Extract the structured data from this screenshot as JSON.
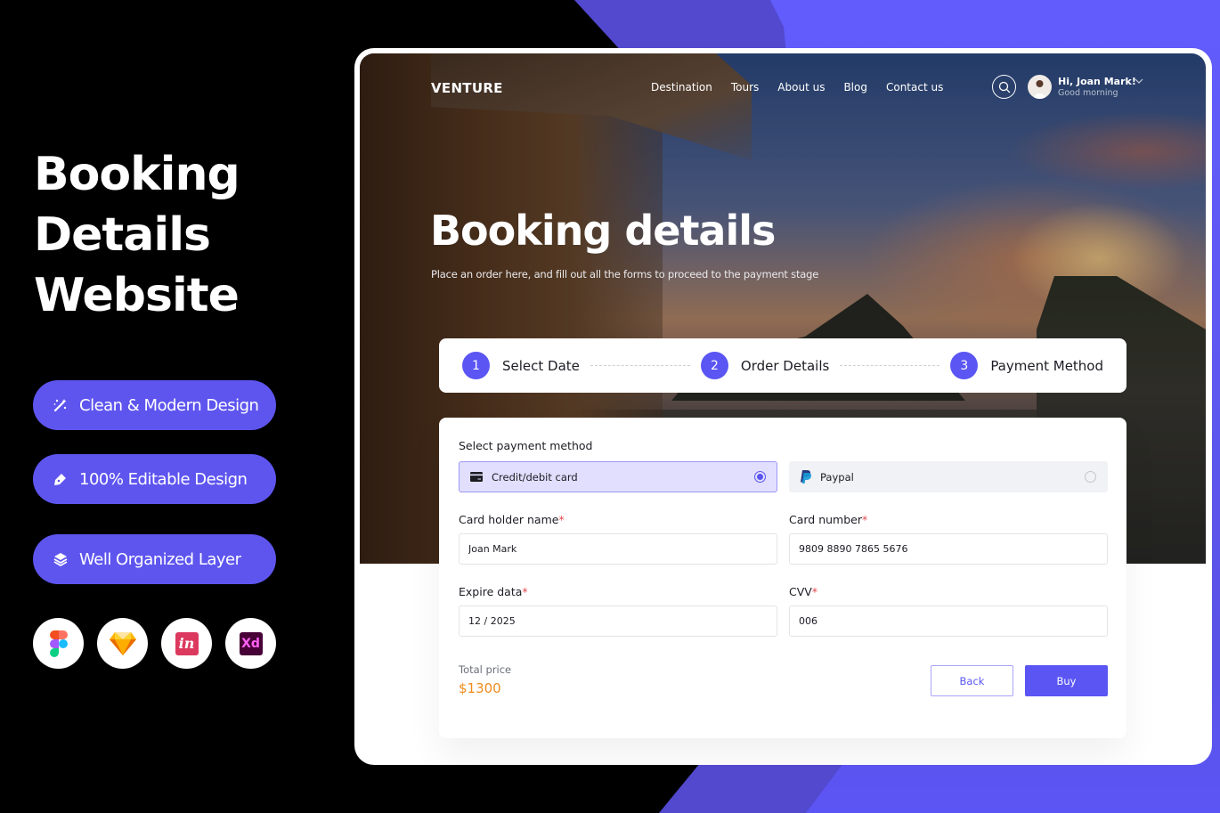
{
  "promo": {
    "title_lines": [
      "Booking",
      "Details",
      "Website"
    ],
    "features": [
      {
        "icon": "magic-wand-icon",
        "label": "Clean & Modern  Design"
      },
      {
        "icon": "pen-edit-icon",
        "label": "100% Editable Design"
      },
      {
        "icon": "layers-icon",
        "label": "Well Organized Layer"
      }
    ],
    "tools": [
      "figma-icon",
      "sketch-icon",
      "invision-icon",
      "adobe-xd-icon"
    ],
    "invision_text": "in",
    "xd_text": "Xd"
  },
  "nav": {
    "logo": "VENTURE",
    "links": [
      "Destination",
      "Tours",
      "About us",
      "Blog",
      "Contact us"
    ],
    "user_name": "Hi, Joan Mark!",
    "user_greeting": "Good morning"
  },
  "hero": {
    "title": "Booking details",
    "subtitle": "Place an order here, and fill out all the forms to proceed to the payment stage"
  },
  "stepper": {
    "steps": [
      {
        "number": "1",
        "label": "Select Date"
      },
      {
        "number": "2",
        "label": "Order Details"
      },
      {
        "number": "3",
        "label": "Payment Method"
      }
    ]
  },
  "payment": {
    "section_label": "Select payment method",
    "methods": [
      {
        "label": "Credit/debit card",
        "selected": true
      },
      {
        "label": "Paypal",
        "selected": false
      }
    ],
    "fields": {
      "card_holder": {
        "label": "Card holder name",
        "value": "Joan Mark"
      },
      "card_number": {
        "label": "Card number",
        "value": "9809 8890 7865 5676"
      },
      "expire": {
        "label": "Expire data",
        "value": "12 / 2025"
      },
      "cvv": {
        "label": "CVV",
        "value": "006"
      }
    },
    "required_mark": "*",
    "total_label": "Total price",
    "total_value": "$1300",
    "back_label": "Back",
    "buy_label": "Buy"
  },
  "colors": {
    "accent": "#5a55f3",
    "price": "#f08b1d",
    "required": "#e5484d",
    "selected_bg": "#e1dffd"
  }
}
